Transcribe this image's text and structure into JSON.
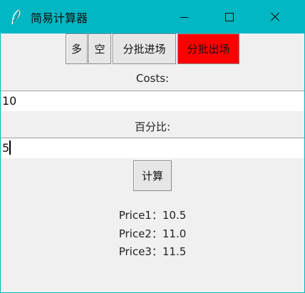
{
  "window": {
    "title": "简易计算器",
    "icon": "feather-icon",
    "controls": [
      "minimize-icon",
      "maximize-icon",
      "close-icon"
    ]
  },
  "toolbar": {
    "buttons": [
      {
        "label": "多"
      },
      {
        "label": "空"
      },
      {
        "label": "分批进场"
      },
      {
        "label": "分批出场",
        "color": "#ff0000"
      }
    ]
  },
  "form": {
    "costs_label": "Costs:",
    "costs_value": "10",
    "percent_label": "百分比:",
    "percent_value": "5",
    "calc_label": "计算"
  },
  "results": [
    "Price1：10.5",
    "Price2：11.0",
    "Price3：11.5"
  ],
  "colors": {
    "titlebar": "#00b7c3",
    "active_button": "#ff0000"
  }
}
